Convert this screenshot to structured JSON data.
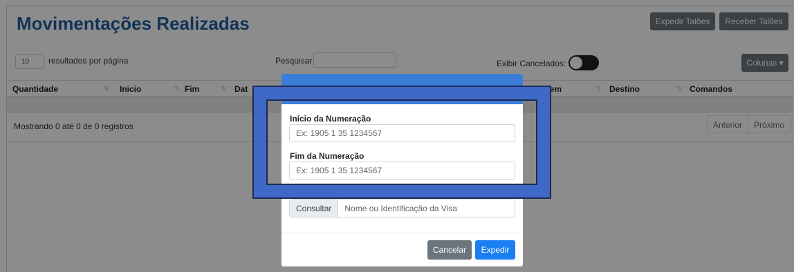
{
  "page": {
    "title": "Movimentações Realizadas",
    "actions": {
      "expedir_taloes": "Expedir Talões",
      "receber_taloes": "Receber Talões"
    }
  },
  "table_controls": {
    "page_size": "10",
    "page_size_label": "resultados por página",
    "search_label": "Pesquisar",
    "show_cancelled_label": "Exibir Cancelados:",
    "show_cancelled": true,
    "columns_button": "Colunas ▾"
  },
  "table": {
    "columns": [
      "Quantidade",
      "Inicio",
      "Fim",
      "Dat",
      "Origem",
      "Destino",
      "Comandos"
    ],
    "sort_glyph": "⇅",
    "rows": []
  },
  "footer": {
    "records_info": "Mostrando 0 até 0 de 0 registros",
    "prev": "Anterior",
    "next": "Próximo"
  },
  "modal": {
    "start_label": "Início da Numeração",
    "start_placeholder": "Ex: 1905 1 35 1234567",
    "end_label": "Fim da Numeração",
    "end_placeholder": "Ex: 1905 1 35 1234567",
    "consult_addon": "Consultar",
    "consult_placeholder": "Nome ou Identificação da Visa",
    "cancel_button": "Cancelar",
    "submit_button": "Expedir"
  },
  "colors": {
    "title": "#1f5fa3",
    "modal_header": "#3b7dd8",
    "highlight": "#3f69c6",
    "primary": "#1a7ff0",
    "secondary": "#6c757d"
  }
}
